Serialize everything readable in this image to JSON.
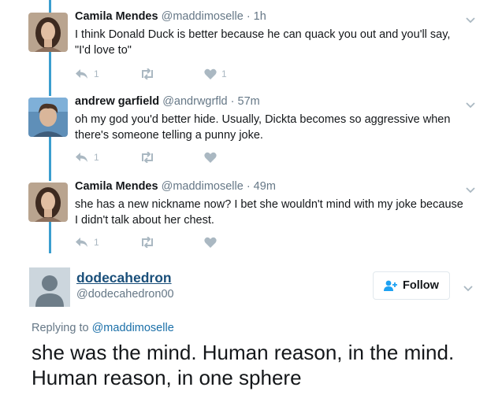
{
  "colors": {
    "thread_line": "#3b9ecf",
    "link": "#1a6fa8",
    "muted": "#657786",
    "action_icon": "#aab8c2"
  },
  "tweets": [
    {
      "name": "Camila Mendes",
      "handle": "@maddimoselle",
      "time": "· 1h",
      "text": "I think Donald Duck is better because he can quack you out and you'll say, \"I'd love to\"",
      "reply_count": "1",
      "like_count": "1",
      "avatar": "woman-portrait"
    },
    {
      "name": "andrew garfield",
      "handle": "@andrwgrfld",
      "time": "· 57m",
      "text": "oh my god you'd better hide. Usually, Dickta becomes so aggressive when there's someone telling a punny joke.",
      "reply_count": "1",
      "like_count": "",
      "avatar": "man-portrait"
    },
    {
      "name": "Camila Mendes",
      "handle": "@maddimoselle",
      "time": "· 49m",
      "text": "she has a new nickname now? I bet she wouldn't mind with my joke because I didn't talk about her chest.",
      "reply_count": "1",
      "like_count": "",
      "avatar": "woman-portrait"
    }
  ],
  "main": {
    "name": "dodecahedron",
    "handle": "@dodecahedron00",
    "follow_label": "Follow",
    "replying_prefix": "Replying to",
    "replying_to": "@maddimoselle",
    "text": "she was the mind.  Human reason, in the mind.  Human reason, in one sphere"
  }
}
